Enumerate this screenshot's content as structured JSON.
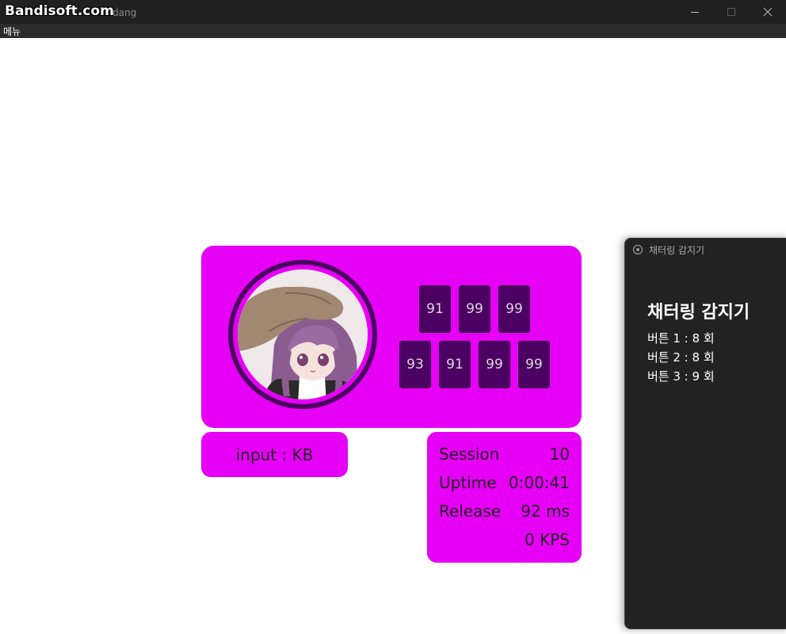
{
  "window": {
    "watermark": "Bandisoft.com",
    "title": "dang"
  },
  "menu": {
    "items": [
      "메뉴"
    ]
  },
  "keys": {
    "row1": [
      "91",
      "99",
      "99"
    ],
    "row2": [
      "93",
      "91",
      "99",
      "99"
    ]
  },
  "input_label": "input : KB",
  "stats": {
    "session_label": "Session",
    "session_value": "10",
    "uptime_label": "Uptime",
    "uptime_value": "0:00:41",
    "release_label": "Release",
    "release_value": "92 ms",
    "kps_value": "0 KPS"
  },
  "chatter_window": {
    "title": "채터링 감지기",
    "heading": "채터링 감지기",
    "lines": [
      "버튼 1 : 8 회",
      "버튼 2 : 8 회",
      "버튼 3 : 9 회"
    ]
  },
  "colors": {
    "accent": "#e600f5",
    "key_bg": "#4d0063",
    "titlebar": "#202020"
  }
}
